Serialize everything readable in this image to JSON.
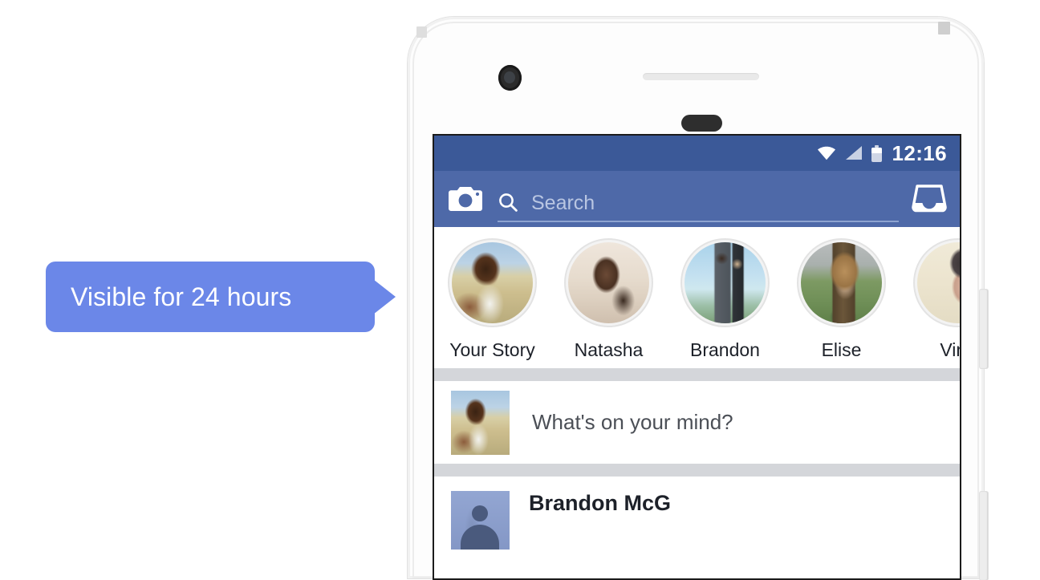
{
  "callout": {
    "text": "Visible for 24 hours",
    "bg_color": "#6b87e8",
    "text_color": "#ffffff"
  },
  "phone": {
    "device_style": "white-android-phone",
    "frame_color": "#fdfdfd",
    "buttons": {
      "power_label": "power-button",
      "volume_label": "volume-button"
    }
  },
  "screen": {
    "status_bar": {
      "time": "12:16",
      "bg_color": "#3b5998",
      "icons": [
        "wifi-icon",
        "signal-icon",
        "battery-icon"
      ]
    },
    "app_bar": {
      "bg_color": "#4e69a8",
      "camera_icon": "camera-icon",
      "search_placeholder": "Search",
      "search_value": "",
      "search_icon": "search-icon",
      "messenger_icon": "messenger-inbox-icon"
    },
    "stories": [
      {
        "name": "Your Story",
        "photo_class": "ph-your"
      },
      {
        "name": "Natasha",
        "photo_class": "ph-natasha"
      },
      {
        "name": "Brandon",
        "photo_class": "ph-brandon"
      },
      {
        "name": "Elise",
        "photo_class": "ph-elise"
      },
      {
        "name": "Vinc",
        "photo_class": "ph-vince"
      }
    ],
    "composer": {
      "placeholder": "What's on your mind?",
      "avatar_class": "ph-your"
    },
    "feed_post": {
      "author": "Brandon McG",
      "avatar_class": "ph-bar"
    }
  }
}
